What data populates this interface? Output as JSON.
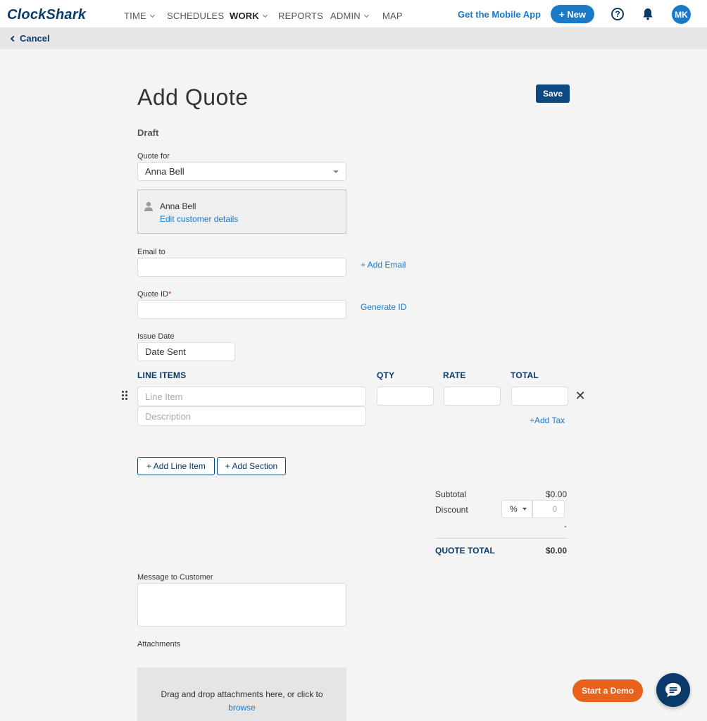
{
  "app": {
    "logo": "ClockShark"
  },
  "nav": {
    "items": [
      {
        "label": "TIME",
        "dropdown": true
      },
      {
        "label": "SCHEDULES",
        "dropdown": false
      },
      {
        "label": "WORK",
        "dropdown": true,
        "active": true
      },
      {
        "label": "REPORTS",
        "dropdown": false
      },
      {
        "label": "ADMIN",
        "dropdown": true
      },
      {
        "label": "MAP",
        "dropdown": false
      }
    ],
    "mobile_app_link": "Get the Mobile App",
    "new_button": "+ New",
    "help_glyph": "?",
    "avatar_initials": "MK"
  },
  "subbar": {
    "cancel_label": "Cancel"
  },
  "page": {
    "title": "Add Quote",
    "save_label": "Save",
    "status": "Draft"
  },
  "form": {
    "quote_for": {
      "label": "Quote for",
      "value": "Anna Bell"
    },
    "customer_card": {
      "name": "Anna Bell",
      "edit_link": "Edit customer details"
    },
    "email_to": {
      "label": "Email to",
      "value": "",
      "add_link": "+ Add Email"
    },
    "quote_id": {
      "label": "Quote ID",
      "required_mark": "*",
      "value": "",
      "generate_link": "Generate ID"
    },
    "issue_date": {
      "label": "Issue Date",
      "value": "Date Sent"
    }
  },
  "line_items": {
    "headers": {
      "item": "LINE ITEMS",
      "qty": "QTY",
      "rate": "RATE",
      "total": "TOTAL"
    },
    "rows": [
      {
        "item_placeholder": "Line Item",
        "description_placeholder": "Description",
        "qty": "",
        "rate": "",
        "total": ""
      }
    ],
    "add_tax_link": "+Add Tax",
    "remove_glyph": "✕",
    "add_line_item_button": "+ Add Line Item",
    "add_section_button": "+ Add Section"
  },
  "summary": {
    "subtotal_label": "Subtotal",
    "subtotal_value": "$0.00",
    "discount_label": "Discount",
    "discount_type": "%",
    "discount_placeholder": "0",
    "discount_value": "-",
    "total_label": "QUOTE TOTAL",
    "total_value": "$0.00"
  },
  "message": {
    "label": "Message to Customer",
    "value": ""
  },
  "attachments": {
    "label": "Attachments",
    "drop_text": "Drag and drop attachments here, or click to",
    "browse_link": "browse"
  },
  "floating": {
    "demo_button": "Start a Demo"
  },
  "colors": {
    "brand_navy": "#0b3a6a",
    "link_blue": "#1a7ac8",
    "save_navy": "#0b4a80",
    "demo_orange": "#e8621c"
  }
}
